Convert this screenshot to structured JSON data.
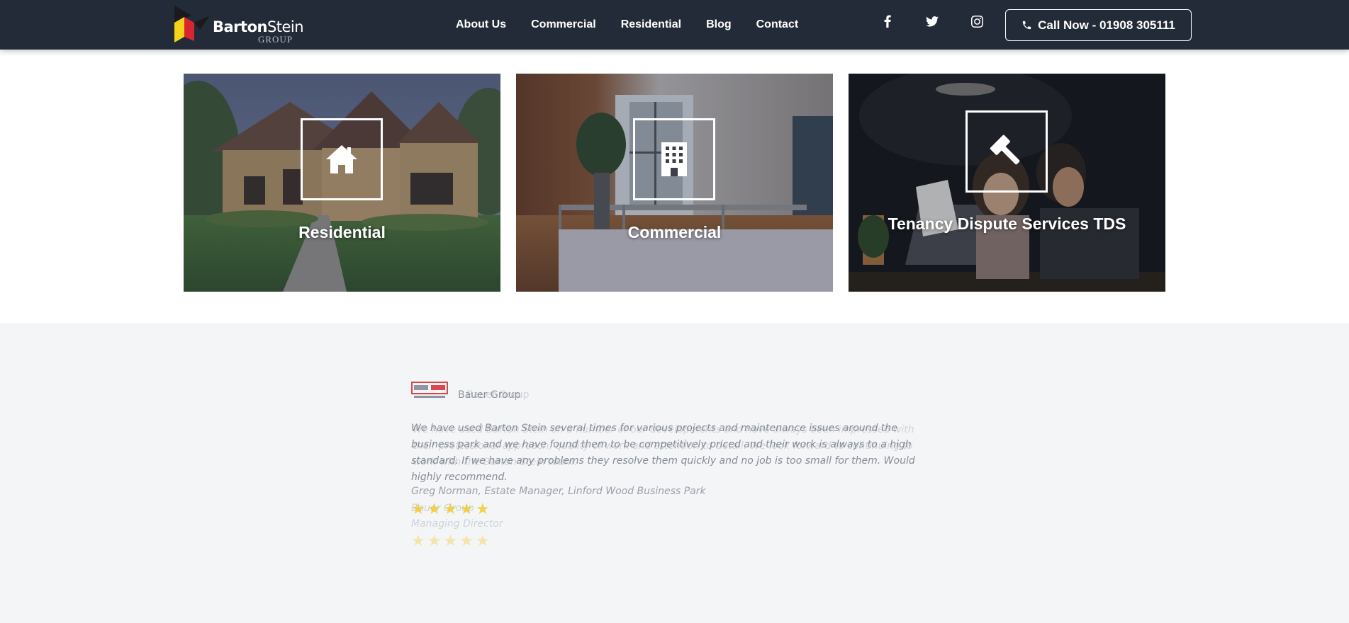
{
  "header": {
    "logo": {
      "brand_bold": "Barton",
      "brand_light": "Stein",
      "sub": "GROUP"
    },
    "nav": [
      {
        "label": "About Us"
      },
      {
        "label": "Commercial"
      },
      {
        "label": "Residential"
      },
      {
        "label": "Blog"
      },
      {
        "label": "Contact"
      }
    ],
    "social": [
      {
        "icon": "facebook-icon"
      },
      {
        "icon": "twitter-icon"
      },
      {
        "icon": "instagram-icon"
      }
    ],
    "call_button": {
      "icon": "phone-icon",
      "label": "Call Now - 01908 305111"
    }
  },
  "services": [
    {
      "title": "Residential",
      "icon": "house-icon"
    },
    {
      "title": "Commercial",
      "icon": "office-building-icon"
    },
    {
      "title": "Tenancy Dispute Services TDS",
      "icon": "gavel-icon"
    }
  ],
  "testimonials": {
    "active": {
      "company": "Bauer Group",
      "quote": "We have used Barton Stein several times for various projects and maintenance issues around the business park and we have found them to be competitively priced and their work is always to a high standard. If we have any problems they resolve them quickly and no job is too small for them. Would highly recommend.",
      "author": "Greg Norman, Estate Manager, Linford Wood Business Park",
      "rating": 5
    },
    "fading": {
      "company": "Bauer Group",
      "quote": "We have used Barton Stein on a number of our developments and have always been impressed with their professional approach, quality of work and attention to detail. We look forward to continuing to work with the Barton Stein team.",
      "author": "Bauer Group",
      "author_role": "Managing Director",
      "rating": 5
    }
  },
  "colors": {
    "header_bg": "#232b38",
    "section_bg": "#f4f5f7",
    "star": "#f5c518",
    "logo_red": "#d7262e",
    "logo_yellow": "#f5d31a"
  }
}
